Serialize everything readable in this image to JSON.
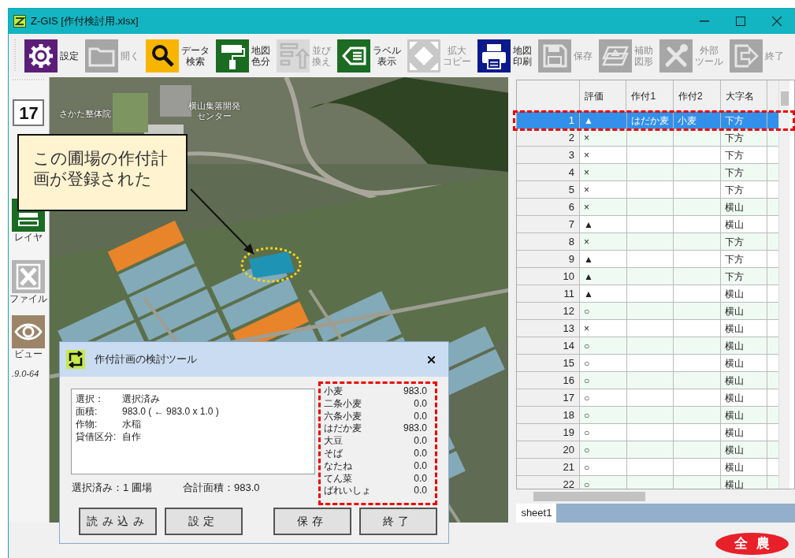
{
  "window": {
    "title": "Z-GIS [作付検討用.xlsx]"
  },
  "toolbar": [
    {
      "lines": [
        "設定"
      ],
      "color": "#5b1e78",
      "disabled": false
    },
    {
      "lines": [
        "開く"
      ],
      "color": "#a6a6a6",
      "disabled": true
    },
    {
      "lines": [
        "データ",
        "検索"
      ],
      "color": "#f7b500",
      "disabled": false
    },
    {
      "lines": [
        "地図",
        "色分"
      ],
      "color": "#1b6b23",
      "disabled": false
    },
    {
      "lines": [
        "並び",
        "換え"
      ],
      "color": "#d9d9d9",
      "disabled": true
    },
    {
      "lines": [
        "ラベル",
        "表示"
      ],
      "color": "#1b6b23",
      "disabled": false
    },
    {
      "lines": [
        "拡大",
        "コピー"
      ],
      "color": "#c8c8c8",
      "disabled": true
    },
    {
      "lines": [
        "地図",
        "印刷"
      ],
      "color": "#0a1a8c",
      "disabled": false
    },
    {
      "lines": [
        "保存"
      ],
      "color": "#a6a6a6",
      "disabled": true
    },
    {
      "lines": [
        "補助",
        "図形"
      ],
      "color": "#a6a6a6",
      "disabled": true
    },
    {
      "lines": [
        "外部",
        "ツール"
      ],
      "color": "#a6a6a6",
      "disabled": true
    },
    {
      "lines": [
        "終了"
      ],
      "color": "#a6a6a6",
      "disabled": true
    }
  ],
  "sidebar": {
    "zoom_level": "17",
    "items": [
      {
        "label": "レイヤ",
        "color": "#1b6b23"
      },
      {
        "label": "ファイル",
        "color": "#b4b4b4"
      },
      {
        "label": "ビュー",
        "color": "#9b8468"
      }
    ],
    "version": ".9.0-64"
  },
  "map": {
    "labels": [
      {
        "lines": [
          "さかた整体院"
        ]
      },
      {
        "lines": [
          "横山集落開発",
          "センター"
        ]
      }
    ],
    "callout": "この圃場の作付計画が登録された"
  },
  "table": {
    "columns": [
      "評価",
      "作付1",
      "作付2",
      "大字名"
    ],
    "rows": [
      {
        "number": "1",
        "rating": "▲",
        "crop1": "はだか麦",
        "crop2": "小麦",
        "district": "下方",
        "selected": true
      },
      {
        "number": "2",
        "rating": "×",
        "district": "下方",
        "selected": false
      },
      {
        "number": "3",
        "rating": "×",
        "district": "下方",
        "selected": false
      },
      {
        "number": "4",
        "rating": "×",
        "district": "下方",
        "selected": false
      },
      {
        "number": "5",
        "rating": "×",
        "district": "下方",
        "selected": false
      },
      {
        "number": "6",
        "rating": "×",
        "district": "横山",
        "selected": false
      },
      {
        "number": "7",
        "rating": "▲",
        "district": "横山",
        "selected": false
      },
      {
        "number": "8",
        "rating": "×",
        "district": "下方",
        "selected": false
      },
      {
        "number": "9",
        "rating": "▲",
        "district": "下方",
        "selected": false
      },
      {
        "number": "10",
        "rating": "▲",
        "district": "下方",
        "selected": false
      },
      {
        "number": "11",
        "rating": "▲",
        "district": "横山",
        "selected": false
      },
      {
        "number": "12",
        "rating": "○",
        "district": "横山",
        "selected": false
      },
      {
        "number": "13",
        "rating": "×",
        "district": "横山",
        "selected": false
      },
      {
        "number": "14",
        "rating": "○",
        "district": "横山",
        "selected": false
      },
      {
        "number": "15",
        "rating": "○",
        "district": "横山",
        "selected": false
      },
      {
        "number": "16",
        "rating": "○",
        "district": "横山",
        "selected": false
      },
      {
        "number": "17",
        "rating": "○",
        "district": "横山",
        "selected": false
      },
      {
        "number": "18",
        "rating": "○",
        "district": "横山",
        "selected": false
      },
      {
        "number": "19",
        "rating": "○",
        "district": "横山",
        "selected": false
      },
      {
        "number": "20",
        "rating": "○",
        "district": "横山",
        "selected": false
      },
      {
        "number": "21",
        "rating": "○",
        "district": "横山",
        "selected": false
      },
      {
        "number": "22",
        "rating": "○",
        "district": "横山",
        "selected": false
      }
    ],
    "sheet_tabs": [
      {
        "label": "sheet1",
        "selected": true
      }
    ]
  },
  "dialog": {
    "title": "作付計画の検討ツール",
    "details": [
      {
        "label": "選択：",
        "value": "選択済み"
      },
      {
        "label": "面積:",
        "value": "983.0 ( ← 983.0 x 1.0 )"
      },
      {
        "label": "作物:",
        "value": "水稲"
      },
      {
        "label": "貸借区分:",
        "value": "自作"
      }
    ],
    "selected_count": "選択済み：1 圃場",
    "total_area": "合計面積：983.0",
    "crops": [
      {
        "name": "小麦",
        "area": "983.0"
      },
      {
        "name": "二条小麦",
        "area": "0.0"
      },
      {
        "name": "六条小麦",
        "area": "0.0"
      },
      {
        "name": "はだか麦",
        "area": "983.0"
      },
      {
        "name": "大豆",
        "area": "0.0"
      },
      {
        "name": "そば",
        "area": "0.0"
      },
      {
        "name": "なたね",
        "area": "0.0"
      },
      {
        "name": "てん菜",
        "area": "0.0"
      },
      {
        "name": "ばれいしょ",
        "area": "0.0"
      }
    ],
    "buttons": [
      "読み込み",
      "設定",
      "保存",
      "終了"
    ]
  },
  "logo": "全農"
}
